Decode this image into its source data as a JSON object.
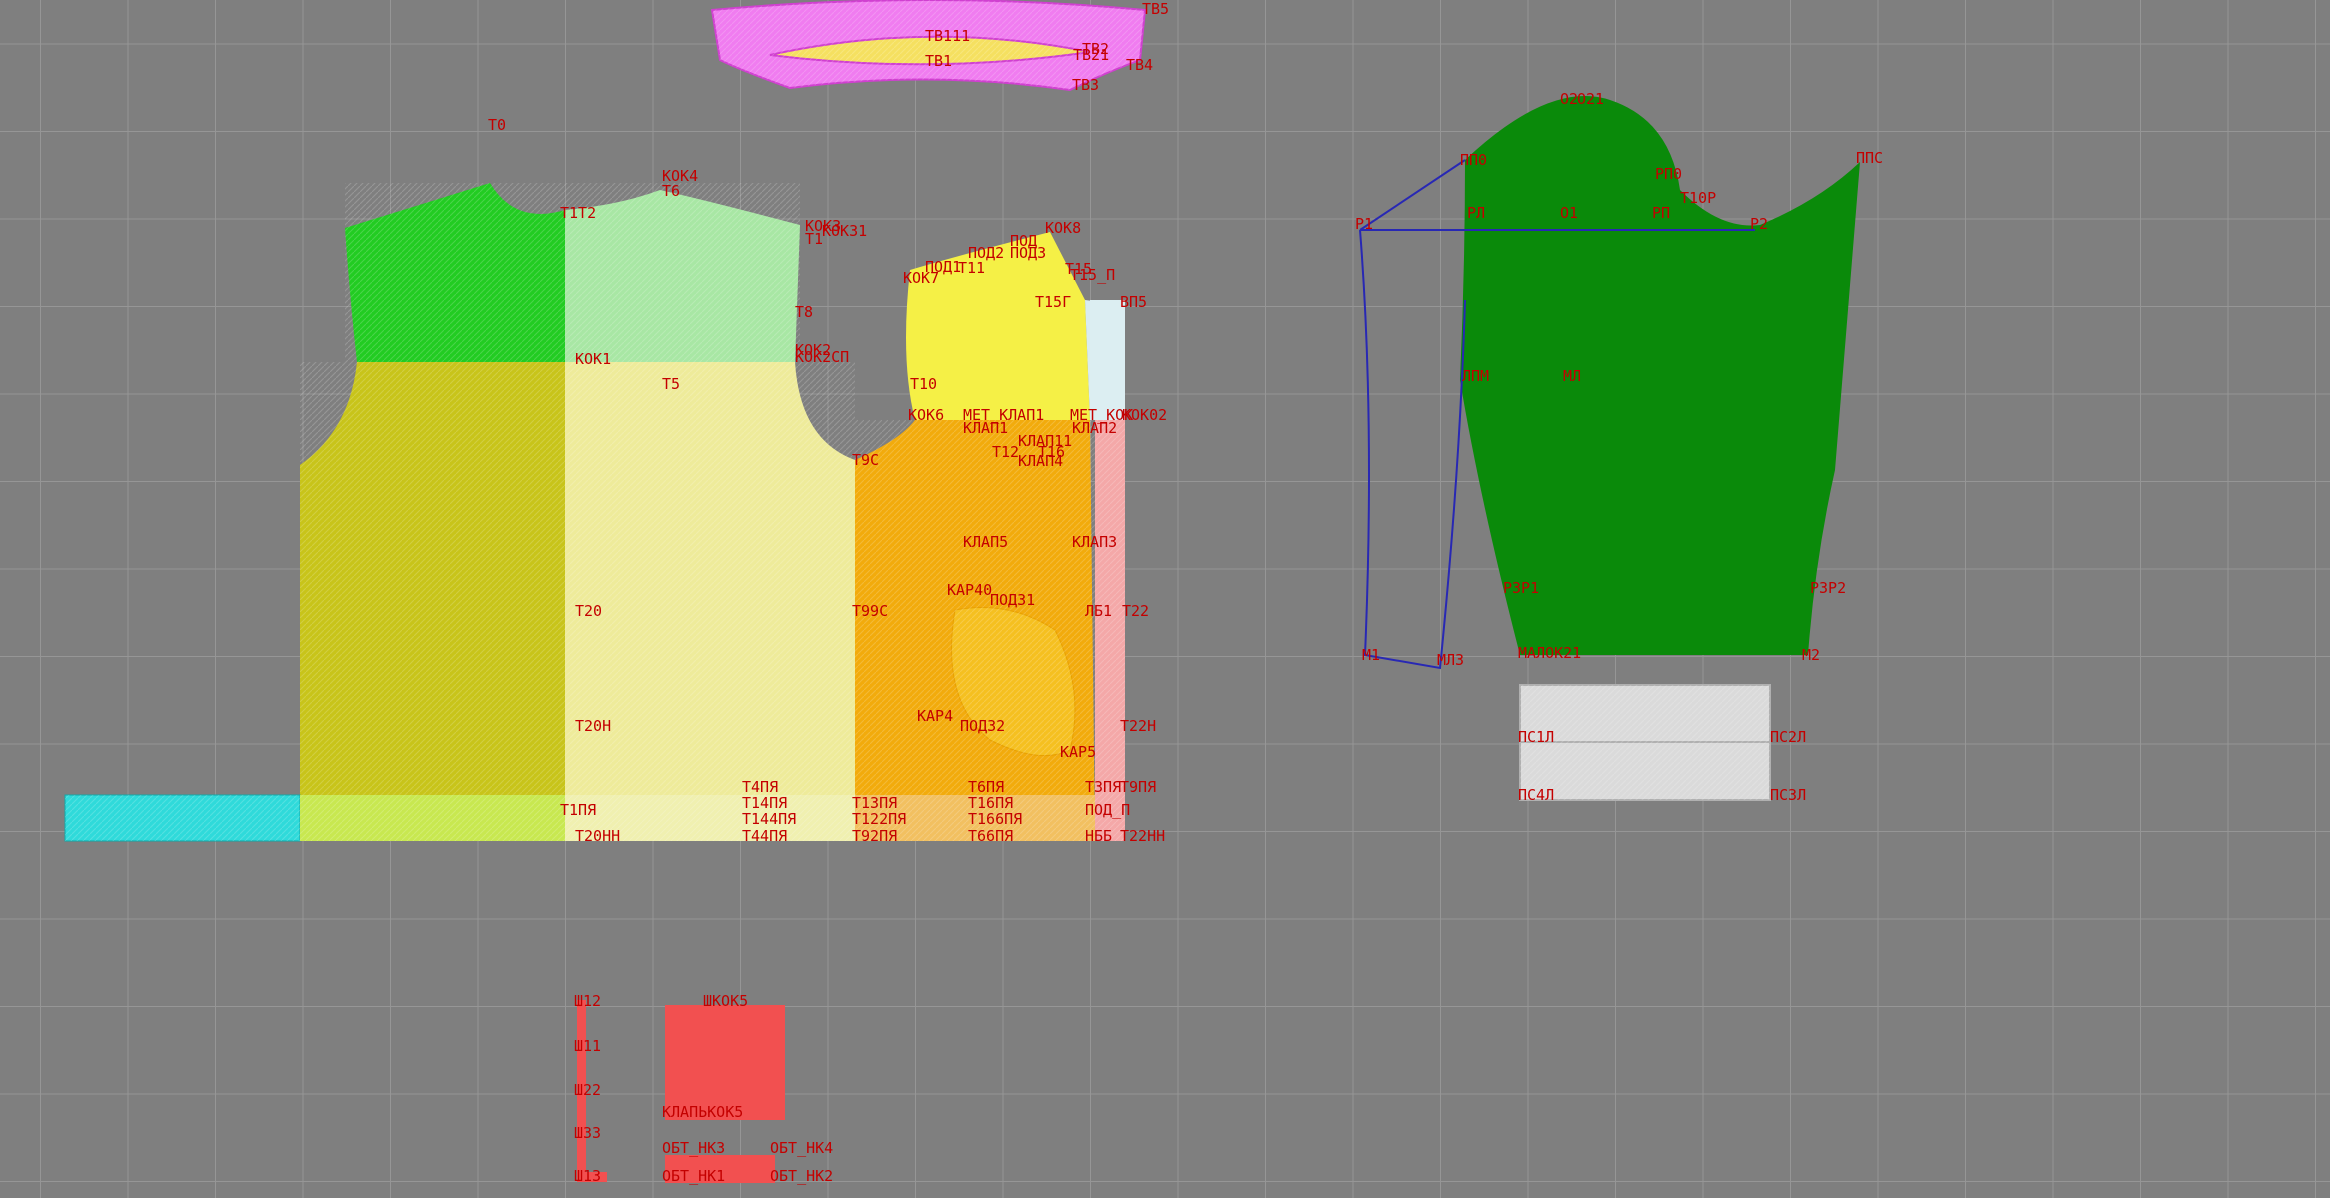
{
  "colors": {
    "background": "#7f7f7f",
    "grid": "#969696",
    "label": "#c40000",
    "green_dark": "#149614",
    "green_bright": "#22cc22",
    "green_light": "#a8e7a4",
    "olive_yellow": "#c8c41a",
    "pale_yellow": "#eeeb9a",
    "bright_yellow": "#f5f046",
    "orange": "#f2ab0c",
    "cyan": "#2fdada",
    "magenta": "#f07cf0",
    "red": "#f25050",
    "light_grey": "#dadada",
    "sleeve_green": "#0a8a0a",
    "outline_blue": "#2828b4"
  },
  "labels": {
    "tb5": "ТВ5",
    "tb111": "ТВ111",
    "tb2": "ТВ2",
    "tb1": "ТВ1",
    "tb21": "ТВ21",
    "tb4": "ТВ4",
    "tb3": "ТВ3",
    "t0": "Т0",
    "kok4": "КОК4",
    "t6": "Т6",
    "t1t2": "Т1Т2",
    "kok3": "КОК3",
    "kok31": "КОК31",
    "t1": "Т1",
    "t8": "Т8",
    "kok2": "КОК2",
    "kok2sp": "КОК2СП",
    "kok1": "КОК1",
    "t5": "Т5",
    "kok8": "КОК8",
    "pod": "ПОД",
    "pod2": "ПОД2",
    "pod3": "ПОД3",
    "pod1": "ПОД1",
    "kok7": "КОК7",
    "t11": "Т11",
    "t15": "Т15",
    "t15p": "Т15_П",
    "t15g": "Т15Г",
    "vp5": "ВП5",
    "t10": "Т10",
    "kok6": "КОК6",
    "met_klap1": "МЕТ_КЛАП1",
    "met_kok": "МЕТ_КОК",
    "kok02": "КОК02",
    "klap1": "КЛАП1",
    "klap2": "КЛАП2",
    "klap11": "КЛАП11",
    "t12": "Т12",
    "t16": "Т16",
    "klap4": "КЛАП4",
    "t9c": "Т9С",
    "klap5": "КЛАП5",
    "klap3": "КЛАП3",
    "kar40": "КАР40",
    "pod31": "ПОД31",
    "t20": "Т20",
    "t99c": "Т99С",
    "lb1": "ЛБ1",
    "t22": "Т22",
    "kar4": "КАР4",
    "pod32": "ПОД32",
    "t20n": "Т20Н",
    "t22n": "Т22Н",
    "kar5": "КАР5",
    "t4pya": "Т4ПЯ",
    "t6pya": "Т6ПЯ",
    "t3pya": "Т3ПЯ",
    "t9pya": "Т9ПЯ",
    "t1pya": "Т1ПЯ",
    "t14pya": "Т14ПЯ",
    "t13pya": "Т13ПЯ",
    "t16pya": "Т16ПЯ",
    "pod_p": "ПОД_П",
    "t144pya": "Т144ПЯ",
    "t122pya": "Т122ПЯ",
    "t166pya": "Т166ПЯ",
    "t20nn": "Т20НН",
    "t44pya": "Т44ПЯ",
    "t92pya": "Т92ПЯ",
    "t66pya": "Т66ПЯ",
    "nbb": "НББ",
    "t22nn": "Т22НН",
    "o2": "О2",
    "o21": "О21",
    "pp0": "ПП0",
    "pps": "ППС",
    "rp0": "РП0",
    "t10r": "Т10Р",
    "r1": "Р1",
    "rl": "РЛ",
    "o1": "О1",
    "rp": "РП",
    "r2": "Р2",
    "lpm": "ЛПМ",
    "ml": "МЛ",
    "rzr1": "РЗР1",
    "rzr2": "РЗР2",
    "m1": "М1",
    "mlz": "МЛЗ",
    "m2": "М2",
    "malok21": "МАЛОК21",
    "ps1l": "ПС1Л",
    "ps2l": "ПС2Л",
    "ps4l": "ПС4Л",
    "ps3l": "ПС3Л",
    "sh12": "Ш12",
    "sh11": "Ш11",
    "sh22": "Ш22",
    "sh33": "Ш33",
    "sh13": "Ш13",
    "sh_top": "ШКОК5",
    "klap_bottom": "КЛАПЬКОК5",
    "obt_nk3": "ОБТ_НК3",
    "obt_nk4": "ОБТ_НК4",
    "obt_nk1": "ОБТ_НК1",
    "obt_nk2": "ОБТ_НК2"
  }
}
